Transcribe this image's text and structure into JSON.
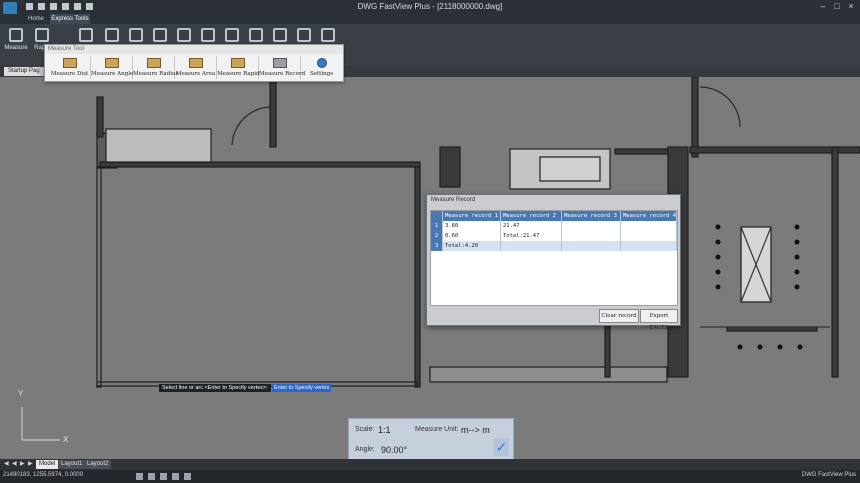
{
  "window": {
    "title": "DWG FastView Plus - [2118000000.dwg]"
  },
  "ribbon": {
    "tabs": [
      "Home",
      "Express Tools"
    ],
    "buttons": [
      "Measure",
      "Rapid"
    ]
  },
  "doc_tabs": [
    "Startup Page",
    "×"
  ],
  "measure_tool": {
    "title": "Measure Tool",
    "tools": [
      "Measure Dist",
      "Measure Angle",
      "Measure Radius",
      "Measure Area",
      "Measure Rapid",
      "Measure Record",
      "Settings"
    ]
  },
  "measure_record": {
    "title": "Measure Record",
    "headers": [
      "Measure record 1",
      "Measure record 2",
      "Measure record 3",
      "Measure record 4"
    ],
    "rows": [
      {
        "num": "1",
        "cells": [
          "3.60",
          "21.47",
          "",
          ""
        ]
      },
      {
        "num": "2",
        "cells": [
          "0.60",
          "Total:21.47",
          "",
          ""
        ]
      },
      {
        "num": "3",
        "cells": [
          "Total:4.20",
          "",
          "",
          ""
        ]
      }
    ],
    "clear_button": "Clear record",
    "export_button": "Export EXCEL"
  },
  "command": {
    "prompt": "Select line or arc <Enter to Specify vertex>:",
    "input": "Enter to Specify vertex"
  },
  "scale_box": {
    "scale_label": "Scale:",
    "scale_value": "1:1",
    "unit_label": "Measure Unit:",
    "unit_value": "m--> m",
    "angle_label": "Angle:",
    "angle_value": "90.00°"
  },
  "axis": {
    "x": "X",
    "y": "Y"
  },
  "layout_tabs": [
    "Model",
    "Layout1",
    "Layout2"
  ],
  "status": {
    "coords": "21490183, 1255.5974, 0.0000",
    "brand": "DWG FastView Plus"
  },
  "colors": {
    "accent": "#4a78b5",
    "ribbon": "#3a3f45",
    "titlebar": "#2b3036",
    "canvas": "#7b7b7b"
  }
}
